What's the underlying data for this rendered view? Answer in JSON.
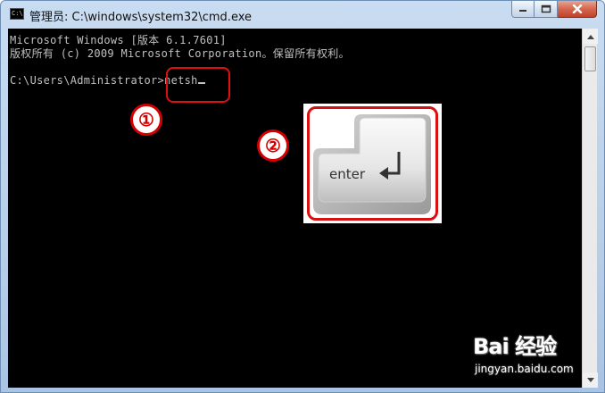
{
  "window": {
    "title": "管理员: C:\\windows\\system32\\cmd.exe",
    "icon_label": "C:\\"
  },
  "console": {
    "lines": [
      "Microsoft Windows [版本 6.1.7601]",
      "版权所有 (c) 2009 Microsoft Corporation。保留所有权利。",
      "",
      "C:\\Users\\Administrator>netsh"
    ]
  },
  "annotations": {
    "step1": "①",
    "step2": "②",
    "key_label": "enter",
    "highlight_color": "#e01010"
  },
  "watermark": {
    "logo": "Bai 经验",
    "url": "jingyan.baidu.com"
  },
  "icons": {
    "minimize": "minimize-icon",
    "maximize": "maximize-icon",
    "close": "close-icon",
    "scroll_up": "scroll-up-arrow-icon",
    "scroll_down": "scroll-down-arrow-icon"
  }
}
